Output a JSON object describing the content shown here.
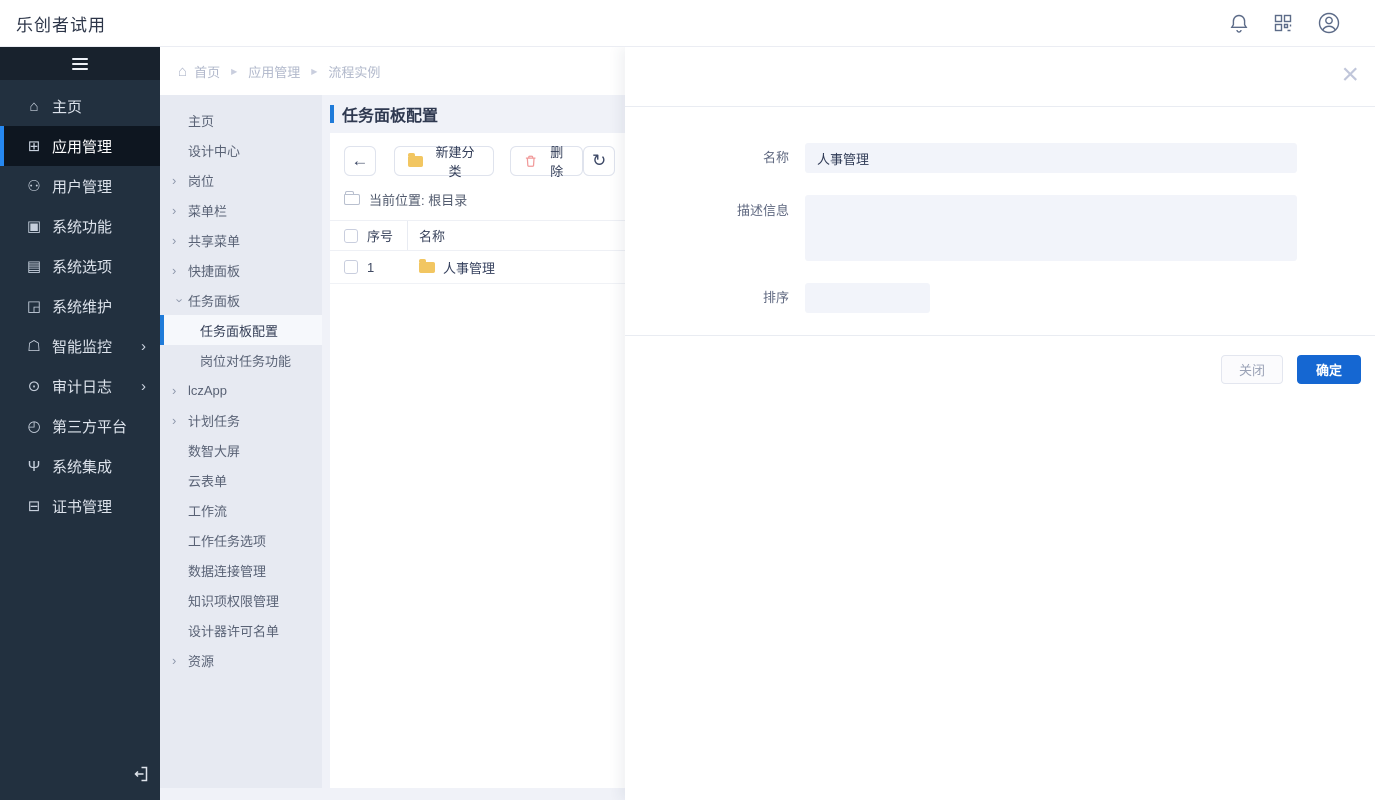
{
  "app": {
    "title": "乐创者试用"
  },
  "topbar": {
    "icons": [
      "bell-icon",
      "qr-code-icon",
      "user-avatar-icon"
    ]
  },
  "breadcrumb": {
    "items": [
      "首页",
      "应用管理",
      "流程实例"
    ]
  },
  "sidebar": {
    "items": [
      {
        "label": "主页",
        "icon": "home-icon",
        "glyph": "⌂"
      },
      {
        "label": "应用管理",
        "icon": "apps-grid-icon",
        "glyph": "⊞",
        "active": true
      },
      {
        "label": "用户管理",
        "icon": "users-icon",
        "glyph": "⚇"
      },
      {
        "label": "系统功能",
        "icon": "system-functions-icon",
        "glyph": "▣"
      },
      {
        "label": "系统选项",
        "icon": "system-options-icon",
        "glyph": "▤"
      },
      {
        "label": "系统维护",
        "icon": "system-maintenance-icon",
        "glyph": "◲"
      },
      {
        "label": "智能监控",
        "icon": "smart-monitor-icon",
        "glyph": "☖",
        "chev": true
      },
      {
        "label": "审计日志",
        "icon": "audit-log-icon",
        "glyph": "⊙",
        "chev": true
      },
      {
        "label": "第三方平台",
        "icon": "third-party-icon",
        "glyph": "◴"
      },
      {
        "label": "系统集成",
        "icon": "integration-icon",
        "glyph": "Ψ"
      },
      {
        "label": "证书管理",
        "icon": "certificate-icon",
        "glyph": "⊟"
      }
    ]
  },
  "submenu": {
    "items": [
      {
        "label": "主页"
      },
      {
        "label": "设计中心"
      },
      {
        "label": "岗位",
        "chev": true
      },
      {
        "label": "菜单栏",
        "chev": true
      },
      {
        "label": "共享菜单",
        "chev": true
      },
      {
        "label": "快捷面板",
        "chev": true
      },
      {
        "label": "任务面板",
        "chev": true,
        "down": true
      },
      {
        "label": "任务面板配置",
        "child": true,
        "active": true
      },
      {
        "label": "岗位对任务功能",
        "child": true
      },
      {
        "label": "lczApp",
        "chev": true
      },
      {
        "label": "计划任务",
        "chev": true
      },
      {
        "label": "数智大屏"
      },
      {
        "label": "云表单"
      },
      {
        "label": "工作流"
      },
      {
        "label": "工作任务选项"
      },
      {
        "label": "数据连接管理"
      },
      {
        "label": "知识项权限管理"
      },
      {
        "label": "设计器许可名单"
      },
      {
        "label": "资源",
        "chev": true
      }
    ]
  },
  "panel": {
    "title": "任务面板配置",
    "toolbar": {
      "back_icon": "arrow-left-icon",
      "back_glyph": "←",
      "new_category": "新建分类",
      "delete": "删除",
      "refresh_icon": "refresh-icon",
      "refresh_glyph": "↻"
    },
    "location": "当前位置: 根目录",
    "table": {
      "columns": [
        "序号",
        "名称"
      ],
      "rows": [
        {
          "index": "1",
          "name": "人事管理"
        }
      ]
    }
  },
  "modal": {
    "close_glyph": "×",
    "fields": {
      "name_label": "名称",
      "name_value": "人事管理",
      "desc_label": "描述信息",
      "desc_value": "",
      "sort_label": "排序",
      "sort_value": ""
    },
    "buttons": {
      "close": "关闭",
      "confirm": "确定"
    }
  },
  "colors": {
    "primary_blue": "#1567d2",
    "accent_bar_blue": "#1f7bd9",
    "sidebar_active_blue": "#2688f0",
    "sidebar_dark": "#22303f",
    "folder_yellow": "#f2c661",
    "delete_red": "#f19a9a"
  }
}
